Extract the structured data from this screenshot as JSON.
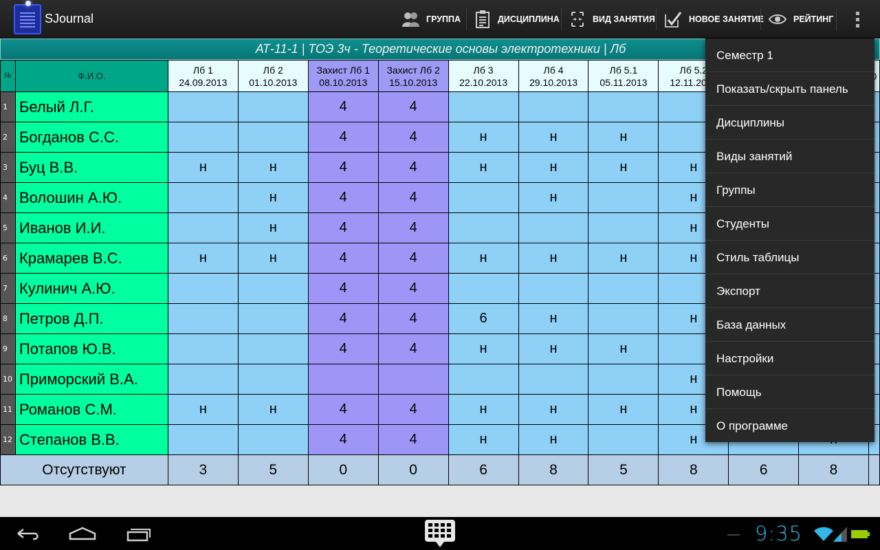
{
  "app": {
    "title": "SJournal",
    "icon": "clipboard-icon"
  },
  "actions": [
    {
      "label": "ГРУППА",
      "icon": "group-icon"
    },
    {
      "label": "ДИСЦИПЛИНА",
      "icon": "document-icon"
    },
    {
      "label": "ВИД ЗАНЯТИЯ",
      "icon": "lesson-type-icon"
    },
    {
      "label": "НОВОЕ ЗАНЯТИЕ",
      "icon": "new-lesson-icon"
    },
    {
      "label": "РЕЙТИНГ",
      "icon": "eye-icon"
    }
  ],
  "journal": {
    "title": "АТ-11-1  |  ТОЭ 3ч - Теоретические основы электротехники  |  Лб",
    "num_header": "№",
    "name_header": "Ф.И.О.",
    "columns": [
      {
        "name": "Лб 1",
        "date": "24.09.2013",
        "defense": false
      },
      {
        "name": "Лб 2",
        "date": "01.10.2013",
        "defense": false
      },
      {
        "name": "Захист Лб 1",
        "date": "08.10.2013",
        "defense": true
      },
      {
        "name": "Захист Лб 2",
        "date": "15.10.2013",
        "defense": true
      },
      {
        "name": "Лб 3",
        "date": "22.10.2013",
        "defense": false
      },
      {
        "name": "Лб 4",
        "date": "29.10.2013",
        "defense": false
      },
      {
        "name": "Лб 5.1",
        "date": "05.11.2013",
        "defense": false
      },
      {
        "name": "Лб 5.2",
        "date": "12.11.2013",
        "defense": false
      },
      {
        "name": "",
        "date": "",
        "defense": false
      },
      {
        "name": "",
        "date": "",
        "defense": false
      },
      {
        "name": "",
        "date": "0",
        "defense": false
      }
    ],
    "rows": [
      {
        "num": "1",
        "name": "Белый Л.Г.",
        "cells": [
          "",
          "",
          "4",
          "4",
          "",
          "",
          "",
          "",
          "",
          "",
          ""
        ]
      },
      {
        "num": "2",
        "name": "Богданов С.С.",
        "cells": [
          "",
          "",
          "4",
          "4",
          "н",
          "н",
          "н",
          "",
          "",
          "",
          ""
        ]
      },
      {
        "num": "3",
        "name": "Буц В.В.",
        "cells": [
          "н",
          "н",
          "4",
          "4",
          "н",
          "н",
          "н",
          "н",
          "",
          "",
          ""
        ]
      },
      {
        "num": "4",
        "name": "Волошин А.Ю.",
        "cells": [
          "",
          "н",
          "4",
          "4",
          "",
          "н",
          "",
          "н",
          "",
          "",
          ""
        ]
      },
      {
        "num": "5",
        "name": "Иванов И.И.",
        "cells": [
          "",
          "н",
          "4",
          "4",
          "",
          "",
          "",
          "н",
          "",
          "",
          ""
        ]
      },
      {
        "num": "6",
        "name": "Крамарев В.С.",
        "cells": [
          "н",
          "н",
          "4",
          "4",
          "н",
          "н",
          "н",
          "н",
          "",
          "",
          ""
        ]
      },
      {
        "num": "7",
        "name": "Кулинич А.Ю.",
        "cells": [
          "",
          "",
          "4",
          "4",
          "",
          "",
          "",
          "",
          "",
          "",
          ""
        ]
      },
      {
        "num": "8",
        "name": "Петров Д.П.",
        "cells": [
          "",
          "",
          "4",
          "4",
          "6",
          "н",
          "",
          "н",
          "",
          "",
          ""
        ]
      },
      {
        "num": "9",
        "name": "Потапов Ю.В.",
        "cells": [
          "",
          "",
          "4",
          "4",
          "н",
          "н",
          "н",
          "",
          "",
          "",
          ""
        ]
      },
      {
        "num": "10",
        "name": "Приморский В.А.",
        "cells": [
          "",
          "",
          "",
          "",
          "",
          "",
          "",
          "н",
          "",
          "",
          ""
        ]
      },
      {
        "num": "11",
        "name": "Романов С.М.",
        "cells": [
          "н",
          "н",
          "4",
          "4",
          "н",
          "н",
          "н",
          "н",
          "",
          "",
          ""
        ]
      },
      {
        "num": "12",
        "name": "Степанов В.В.",
        "cells": [
          "",
          "",
          "4",
          "4",
          "н",
          "н",
          "",
          "н",
          "",
          "н",
          ""
        ]
      }
    ],
    "footer": {
      "label": "Отсутствуют",
      "values": [
        "3",
        "5",
        "0",
        "0",
        "6",
        "8",
        "5",
        "8",
        "6",
        "8",
        ""
      ]
    }
  },
  "menu": [
    "Семестр 1",
    "Показать/скрыть панель",
    "Дисциплины",
    "Виды занятий",
    "Группы",
    "Студенты",
    "Стиль таблицы",
    "Экспорт",
    "База данных",
    "Настройки",
    "Помощь",
    "О программе"
  ],
  "status": {
    "time": "9:35"
  },
  "colors": {
    "name_col": "#00ff9f",
    "cell": "#8fd0f7",
    "defense": "#9d96f7",
    "header": "#e7fcff",
    "footer": "#b6cfe6",
    "clock": "#33b5e5"
  }
}
